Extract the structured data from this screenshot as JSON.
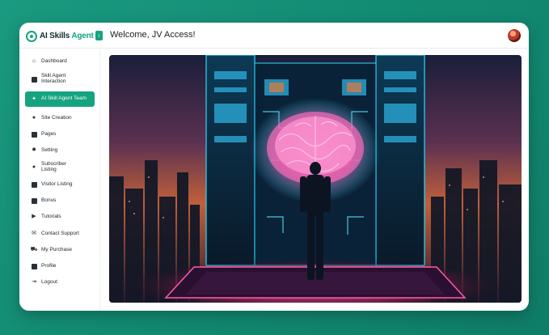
{
  "header": {
    "logo_prefix": "AI Skills",
    "logo_accent": "Agent",
    "welcome": "Welcome, JV Access!"
  },
  "sidebar": {
    "items": [
      {
        "label": "Dashboard",
        "icon": "home-icon",
        "active": false
      },
      {
        "label": "Skill Agent Interaction",
        "icon": "id-card-icon",
        "active": false
      },
      {
        "label": "AI Skill Agent Team",
        "icon": "gear-sparkle-icon",
        "active": true
      },
      {
        "label": "Site Creation",
        "icon": "globe-icon",
        "active": false
      },
      {
        "label": "Pages",
        "icon": "page-icon",
        "active": false
      },
      {
        "label": "Setting",
        "icon": "settings-icon",
        "active": false
      },
      {
        "label": "Subscriber Listing",
        "icon": "users-icon",
        "active": false
      },
      {
        "label": "Visitor Listing",
        "icon": "film-icon",
        "active": false
      },
      {
        "label": "Bonus",
        "icon": "gift-icon",
        "active": false
      },
      {
        "label": "Tutorials",
        "icon": "video-icon",
        "active": false
      },
      {
        "label": "Contact Support",
        "icon": "envelope-icon",
        "active": false
      },
      {
        "label": "My Purchase",
        "icon": "cart-icon",
        "active": false
      },
      {
        "label": "Profile",
        "icon": "profile-icon",
        "active": false
      },
      {
        "label": "Logout",
        "icon": "logout-icon",
        "active": false
      }
    ]
  },
  "colors": {
    "accent": "#16a37f",
    "background": "#128a72"
  }
}
